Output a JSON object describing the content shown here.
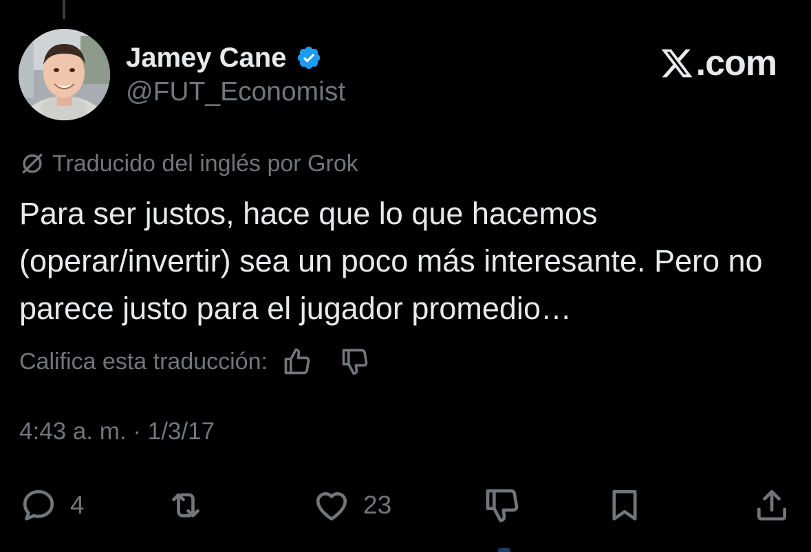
{
  "author": {
    "display_name": "Jamey Cane",
    "handle": "@FUT_Economist",
    "verified": true,
    "avatar_icon": "profile-photo"
  },
  "brand": {
    "text": ".com",
    "logo_icon": "x-logo-icon"
  },
  "translation": {
    "note": "Traducido del inglés por Grok",
    "icon": "grok-icon"
  },
  "tweet": {
    "text": "Para ser justos, hace que lo que hacemos (operar/invertir) sea un poco más interesante. Pero no parece justo para el jugador promedio…"
  },
  "rating": {
    "label": "Califica esta traducción:"
  },
  "meta": {
    "timestamp": "4:43 a. m. · 1/3/17"
  },
  "actions": {
    "reply_count": "4",
    "repost_count": "",
    "like_count": "23"
  },
  "colors": {
    "background": "#000000",
    "text": "#e7e9ea",
    "muted": "#71767b",
    "verified": "#1d9bf0"
  }
}
